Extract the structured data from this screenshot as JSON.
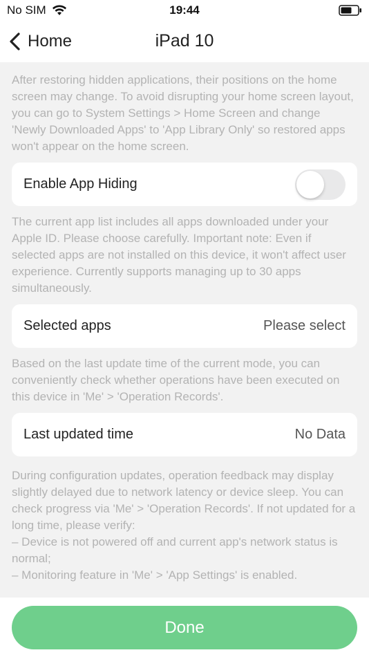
{
  "status_bar": {
    "carrier": "No SIM",
    "time": "19:44",
    "wifi_icon": "wifi-icon",
    "battery_icon": "battery-icon"
  },
  "nav": {
    "back_label": "Home",
    "back_icon": "chevron-left-icon",
    "title": "iPad 10"
  },
  "notes": {
    "restore_info": "After restoring hidden applications, their positions on the home screen may change. To avoid disrupting your home screen layout, you can go to System Settings > Home Screen and change 'Newly Downloaded Apps' to 'App Library Only' so restored apps won't appear on the home screen.",
    "app_list_info": "The current app list includes all apps downloaded under your Apple ID. Please choose carefully. Important note: Even if selected apps are not installed on this device, it won't affect user experience. Currently supports managing up to 30 apps simultaneously.",
    "update_info": "Based on the last update time of the current mode, you can conveniently check whether operations have been executed on this device in 'Me' > 'Operation Records'.",
    "feedback_info_1": "During configuration updates, operation feedback may display slightly delayed due to network latency or device sleep. You can check progress via 'Me' > 'Operation Records'. If not updated for a long time, please verify:",
    "feedback_info_2": "– Device is not powered off and current app's network status is normal;",
    "feedback_info_3": "– Monitoring feature in 'Me' > 'App Settings' is enabled."
  },
  "settings": {
    "enable_app_hiding": {
      "label": "Enable App Hiding",
      "enabled": false
    },
    "selected_apps": {
      "label": "Selected apps",
      "value": "Please select"
    },
    "last_updated": {
      "label": "Last updated time",
      "value": "No Data"
    }
  },
  "footer": {
    "done_label": "Done"
  },
  "colors": {
    "accent": "#6fcf8c",
    "background": "#f2f2f2",
    "note_text": "#b3b3b3"
  }
}
